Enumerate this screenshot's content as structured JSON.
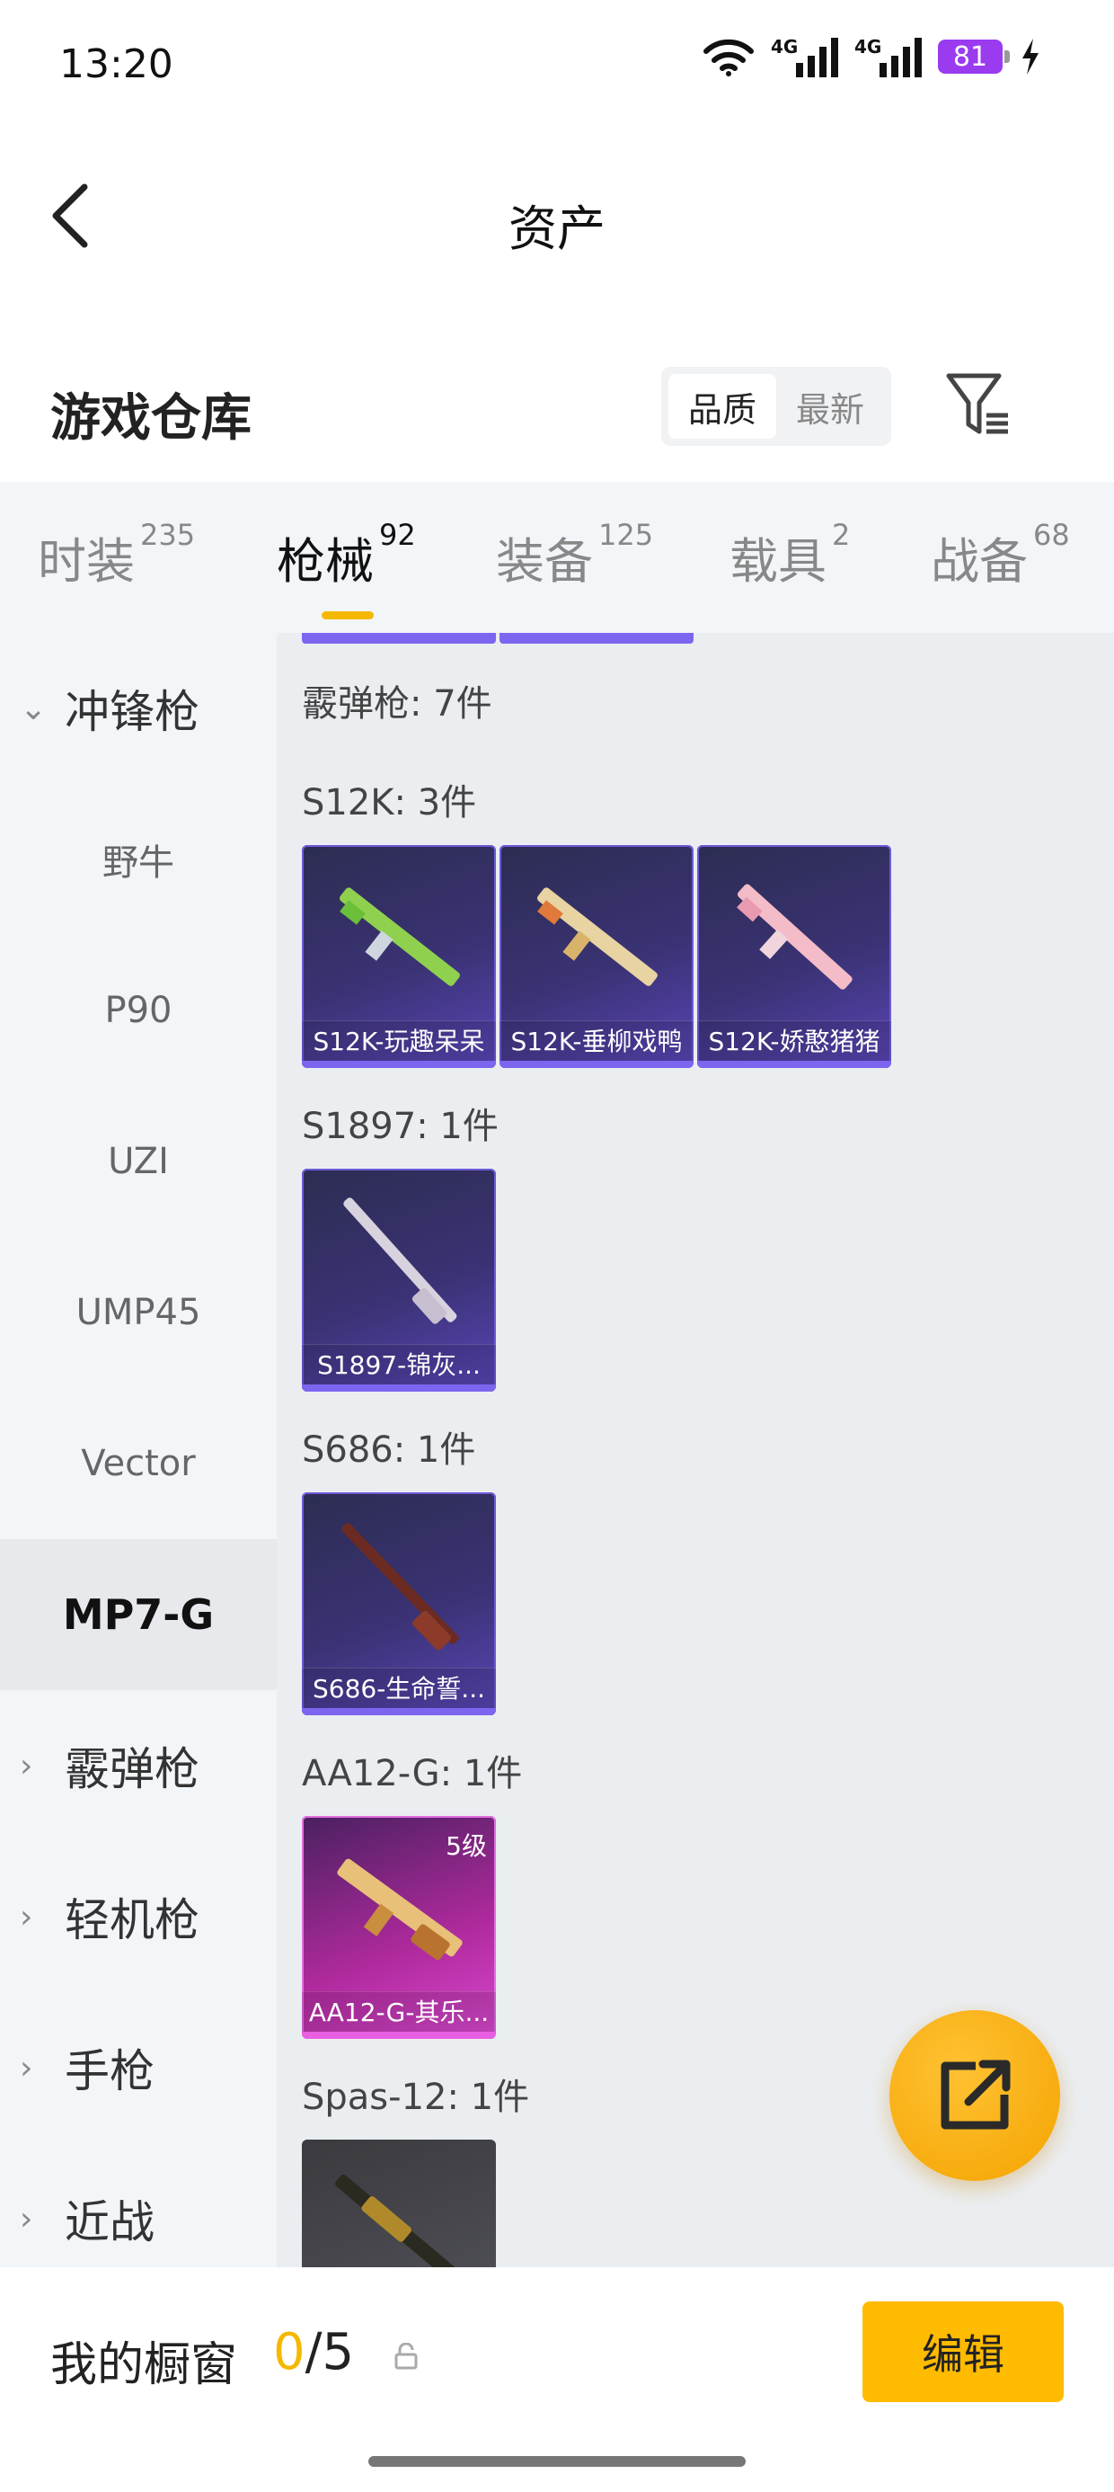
{
  "status_bar": {
    "time": "13:20",
    "battery": "81",
    "net1": "4G",
    "net2": "4G"
  },
  "header": {
    "title": "资产"
  },
  "warehouse": {
    "title": "游戏仓库",
    "sort_quality": "品质",
    "sort_newest": "最新"
  },
  "tabs": [
    {
      "label": "时装",
      "count": "235"
    },
    {
      "label": "枪械",
      "count": "92"
    },
    {
      "label": "装备",
      "count": "125"
    },
    {
      "label": "载具",
      "count": "2"
    },
    {
      "label": "战备",
      "count": "68"
    }
  ],
  "nav": {
    "group_smg": "冲锋枪",
    "smg_items": [
      "野牛",
      "P90",
      "UZI",
      "UMP45",
      "Vector",
      "MP7-G"
    ],
    "group_shotgun": "霰弹枪",
    "group_lmg": "轻机枪",
    "group_pistol": "手枪",
    "group_melee": "近战"
  },
  "content": {
    "shotgun_header": "霰弹枪: 7件",
    "sections": [
      {
        "title": "S12K: 3件",
        "items": [
          "S12K-玩趣呆呆",
          "S12K-垂柳戏鸭",
          "S12K-娇憨猪猪"
        ]
      },
      {
        "title": "S1897: 1件",
        "items": [
          "S1897-锦灰..."
        ]
      },
      {
        "title": "S686: 1件",
        "items": [
          "S686-生命誓..."
        ]
      },
      {
        "title": "AA12-G: 1件",
        "items": [
          "AA12-G-其乐..."
        ],
        "level": "5级"
      },
      {
        "title": "Spas-12: 1件",
        "items": [
          ""
        ]
      }
    ]
  },
  "showcase": {
    "label": "我的橱窗",
    "current": "0",
    "sep_total": "/5",
    "edit_label": "编辑"
  },
  "colors": {
    "accent": "#f5b800",
    "card_purple": "#5a46b8",
    "card_pink": "#d94ad0"
  }
}
